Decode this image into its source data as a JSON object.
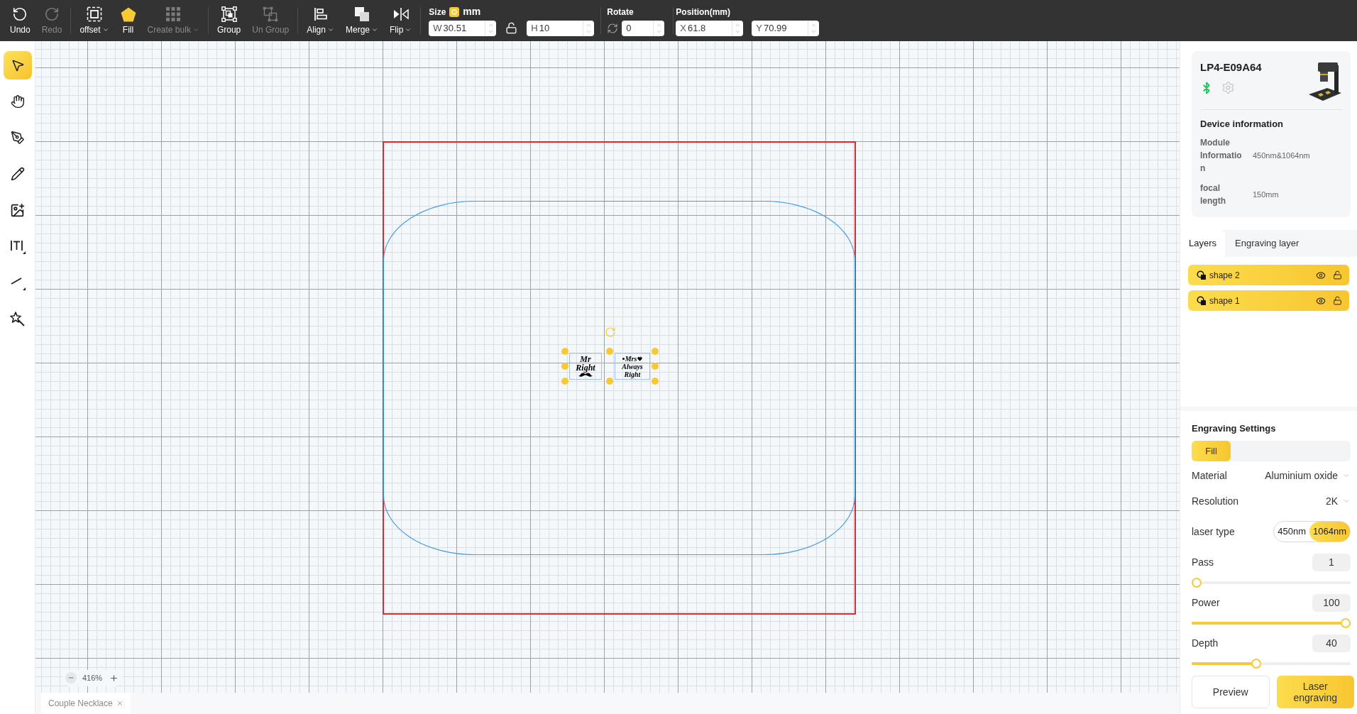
{
  "toolbar": {
    "groups": [
      [
        {
          "kind": "undo",
          "label": "Undo",
          "disabled": false,
          "dropdown": false
        },
        {
          "kind": "redo",
          "label": "Redo",
          "disabled": true,
          "dropdown": false
        }
      ],
      [
        {
          "kind": "offset",
          "label": "offset",
          "disabled": false,
          "dropdown": true
        },
        {
          "kind": "fill",
          "label": "Fill",
          "disabled": false,
          "dropdown": false
        },
        {
          "kind": "bulk",
          "label": "Create bulk",
          "disabled": true,
          "dropdown": true
        }
      ],
      [
        {
          "kind": "group",
          "label": "Group",
          "disabled": false,
          "dropdown": false
        },
        {
          "kind": "ungroup",
          "label": "Un Group",
          "disabled": true,
          "dropdown": false
        }
      ],
      [
        {
          "kind": "align",
          "label": "Align",
          "disabled": false,
          "dropdown": true
        },
        {
          "kind": "merge",
          "label": "Merge",
          "disabled": false,
          "dropdown": true
        },
        {
          "kind": "flip",
          "label": "Flip",
          "disabled": false,
          "dropdown": true
        }
      ]
    ],
    "size": {
      "label": "Size",
      "unit": "mm",
      "unit_checked": true,
      "width": {
        "prefix": "W",
        "value": "30.51"
      },
      "height": {
        "prefix": "H",
        "value": "10"
      },
      "locked": false
    },
    "rotate": {
      "label": "Rotate",
      "value": "0"
    },
    "position": {
      "label": "Position(mm)",
      "x": {
        "prefix": "X",
        "value": "61.8"
      },
      "y": {
        "prefix": "Y",
        "value": "70.99"
      }
    }
  },
  "tools": [
    {
      "kind": "select",
      "selected": true
    },
    {
      "kind": "hand",
      "selected": false
    },
    {
      "kind": "pen",
      "selected": false
    },
    {
      "kind": "pencil",
      "selected": false
    },
    {
      "kind": "image",
      "selected": false
    },
    {
      "kind": "text",
      "selected": false
    },
    {
      "kind": "line",
      "selected": false
    },
    {
      "kind": "shape",
      "selected": false
    }
  ],
  "canvas": {
    "objects": [
      {
        "kind": "mustache",
        "lines": [
          "Mr",
          "Right"
        ],
        "selected": true
      },
      {
        "kind": "heart",
        "lines": [
          "Mrs",
          "Always",
          "Right"
        ],
        "selected": true
      }
    ],
    "zoom": "416%"
  },
  "document_tabs": [
    {
      "title": "Couple Necklace"
    }
  ],
  "device": {
    "name": "LP4-E09A64",
    "bluetooth_connected": true,
    "info_title": "Device information",
    "info": [
      {
        "label": "Module Information",
        "value": "450nm&1064nm"
      },
      {
        "label": "focal length",
        "value": "150mm"
      }
    ]
  },
  "layers_panel": {
    "tabs": [
      {
        "label": "Layers",
        "selected": true
      },
      {
        "label": "Engraving layer",
        "selected": false
      }
    ],
    "layers": [
      {
        "name": "shape 2",
        "selected": true,
        "visible": true,
        "locked": false
      },
      {
        "name": "shape 1",
        "selected": true,
        "visible": true,
        "locked": false
      }
    ]
  },
  "engraving": {
    "title": "Engraving Settings",
    "modes": [
      {
        "label": "Fill",
        "selected": true
      }
    ],
    "material": {
      "label": "Material",
      "value": "Aluminium oxide"
    },
    "resolution": {
      "label": "Resolution",
      "value": "2K"
    },
    "laser_type": {
      "label": "laser type",
      "options": [
        {
          "label": "450nm",
          "selected": false
        },
        {
          "label": "1064nm",
          "selected": true
        }
      ]
    },
    "sliders": [
      {
        "label": "Pass",
        "value": "1",
        "level": 0
      },
      {
        "label": "Power",
        "value": "100",
        "level": 1
      },
      {
        "label": "Depth",
        "value": "40",
        "level": 0.4
      }
    ],
    "buttons": [
      {
        "label": "Preview",
        "primary": false
      },
      {
        "label": "Laser engraving",
        "primary": true
      }
    ]
  }
}
